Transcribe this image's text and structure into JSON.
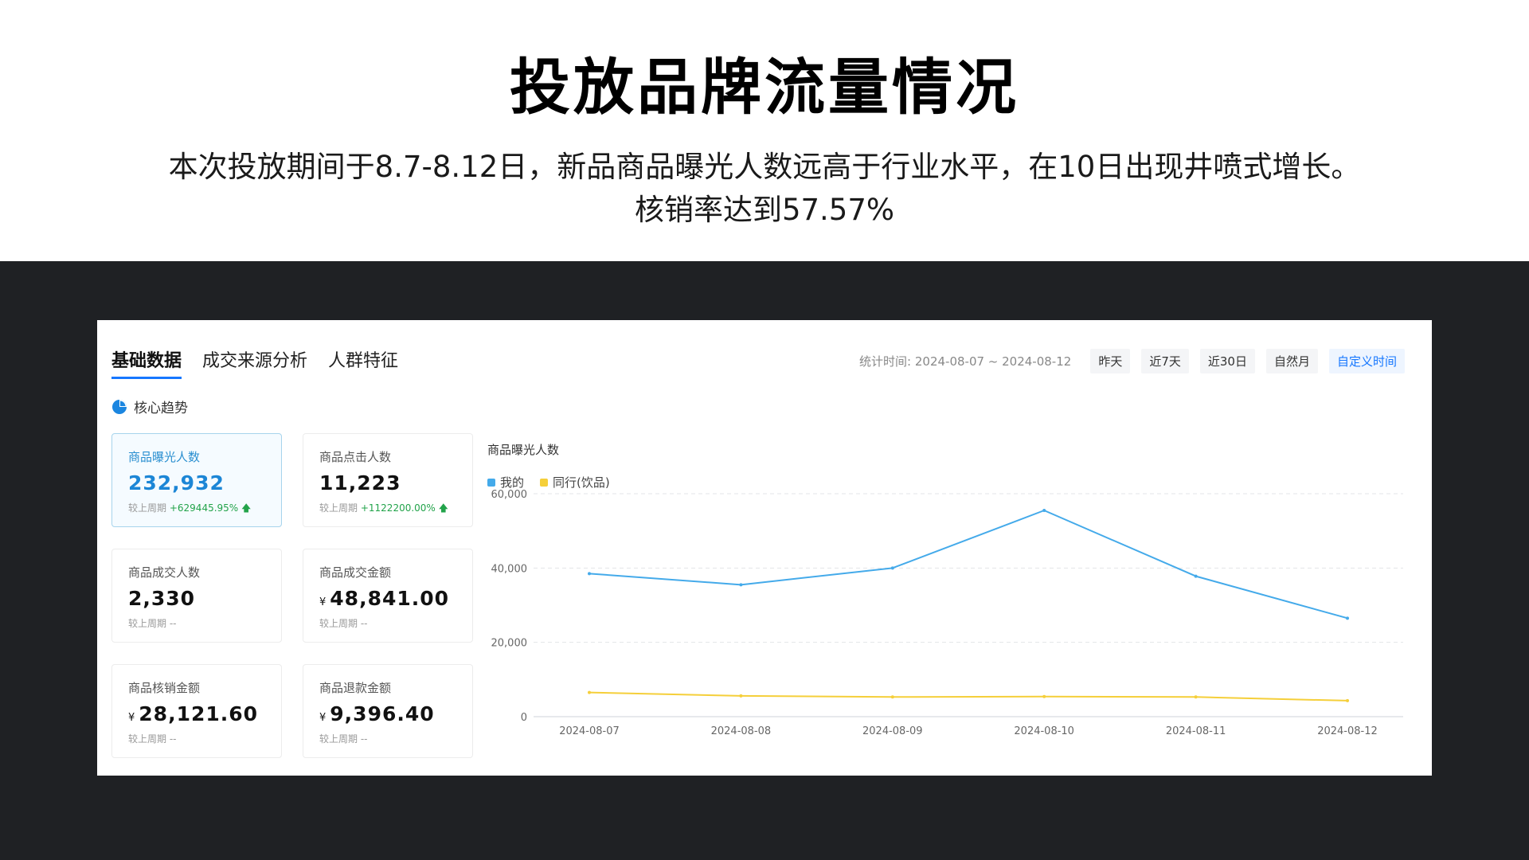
{
  "slide": {
    "title": "投放品牌流量情况",
    "description_line1": "本次投放期间于8.7-8.12日，新品商品曝光人数远高于行业水平，在10日出现井喷式增长。",
    "description_line2": "核销率达到57.57%"
  },
  "tabs": [
    {
      "label": "基础数据",
      "active": true
    },
    {
      "label": "成交来源分析",
      "active": false
    },
    {
      "label": "人群特征",
      "active": false
    }
  ],
  "period": {
    "label": "统计时间: 2024-08-07 ~ 2024-08-12",
    "buttons": [
      {
        "label": "昨天",
        "active": false
      },
      {
        "label": "近7天",
        "active": false
      },
      {
        "label": "近30日",
        "active": false
      },
      {
        "label": "自然月",
        "active": false
      },
      {
        "label": "自定义时间",
        "active": true
      }
    ]
  },
  "section": {
    "label": "核心趋势",
    "icon": "pie-chart-icon"
  },
  "cards": [
    {
      "label": "商品曝光人数",
      "value": "232,932",
      "currency": "",
      "compare_prefix": "较上周期",
      "delta": "+629445.95%",
      "trend": "up",
      "active": true
    },
    {
      "label": "商品点击人数",
      "value": "11,223",
      "currency": "",
      "compare_prefix": "较上周期",
      "delta": "+1122200.00%",
      "trend": "up",
      "active": false
    },
    {
      "label": "商品成交人数",
      "value": "2,330",
      "currency": "",
      "compare_prefix": "较上周期",
      "delta": "--",
      "trend": "none",
      "active": false
    },
    {
      "label": "商品成交金额",
      "value": "48,841.00",
      "currency": "¥",
      "compare_prefix": "较上周期",
      "delta": "--",
      "trend": "none",
      "active": false
    },
    {
      "label": "商品核销金额",
      "value": "28,121.60",
      "currency": "¥",
      "compare_prefix": "较上周期",
      "delta": "--",
      "trend": "none",
      "active": false
    },
    {
      "label": "商品退款金额",
      "value": "9,396.40",
      "currency": "¥",
      "compare_prefix": "较上周期",
      "delta": "--",
      "trend": "none",
      "active": false
    }
  ],
  "colors": {
    "accent": "#1677ff",
    "series_mine": "#44aaea",
    "series_peer": "#f5cf3a",
    "up": "#22a34a"
  },
  "chart_data": {
    "type": "line",
    "title": "商品曝光人数",
    "x": [
      "2024-08-07",
      "2024-08-08",
      "2024-08-09",
      "2024-08-10",
      "2024-08-11",
      "2024-08-12"
    ],
    "series": [
      {
        "name": "我的",
        "color": "#44aaea",
        "values": [
          38500,
          35500,
          40000,
          55500,
          37800,
          26500
        ]
      },
      {
        "name": "同行(饮品)",
        "color": "#f5cf3a",
        "values": [
          6500,
          5600,
          5300,
          5400,
          5300,
          4300
        ]
      }
    ],
    "ylim": [
      0,
      60000
    ],
    "yticks": [
      0,
      20000,
      40000,
      60000
    ],
    "ytick_labels": [
      "0",
      "20,000",
      "40,000",
      "60,000"
    ],
    "grid": true,
    "legend": "top-left"
  }
}
